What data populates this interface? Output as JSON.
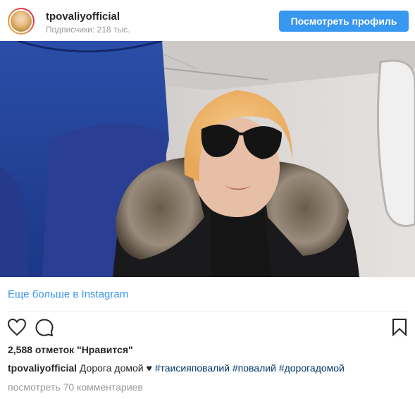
{
  "header": {
    "username": "tpovaliyofficial",
    "followers": "Подписчики: 218 тыс.",
    "profile_button": "Посмотреть профиль"
  },
  "media": {
    "description_icon": "video-still"
  },
  "more_link": "Еще больше в Instagram",
  "actions": {
    "like_icon": "heart-icon",
    "comment_icon": "speech-bubble-icon",
    "save_icon": "bookmark-icon"
  },
  "likes": "2,588 отметок \"Нравится\"",
  "caption": {
    "username": "tpovaliyofficial",
    "text": "Дорога домой",
    "emoji": "♥",
    "tags": [
      "#таисияповалий",
      "#повалий",
      "#дорогадомой"
    ]
  },
  "comments_link": "посмотреть 70 комментариев",
  "colors": {
    "accent": "#3897f0",
    "hashtag": "#003569",
    "muted": "#999999"
  }
}
